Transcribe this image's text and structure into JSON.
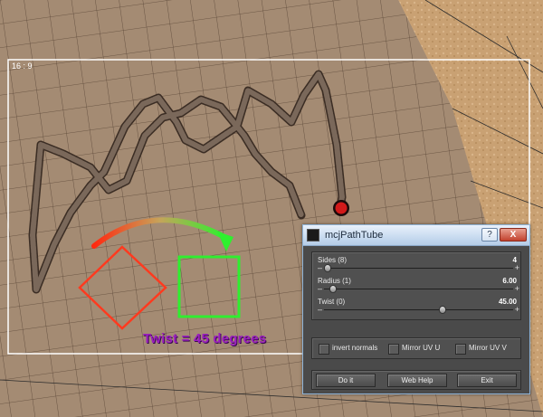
{
  "viewport": {
    "aspect_label": "16 : 9",
    "caption": "Twist = 45 degrees",
    "colors": {
      "square": "#ff3a1f",
      "square_twisted": "#2fee2f",
      "caption": "#9b1fbf",
      "tube": "#6a5a4c",
      "end_marker": "#d11a1a"
    }
  },
  "dialog": {
    "title": "mcjPathTube",
    "icon": "script-icon",
    "help_label": "?",
    "close_label": "X",
    "sliders": [
      {
        "label": "Sides (8)",
        "value": "4",
        "fraction": 0.02
      },
      {
        "label": "Radius (1)",
        "value": "6.00",
        "fraction": 0.05
      },
      {
        "label": "Twist (0)",
        "value": "45.00",
        "fraction": 0.625
      }
    ],
    "checkboxes": [
      {
        "label": "invert normals",
        "checked": false
      },
      {
        "label": "Mirror UV U",
        "checked": false
      },
      {
        "label": "Mirror UV V",
        "checked": false
      }
    ],
    "buttons": {
      "doit": "Do it",
      "webhelp": "Web Help",
      "exit": "Exit"
    }
  }
}
